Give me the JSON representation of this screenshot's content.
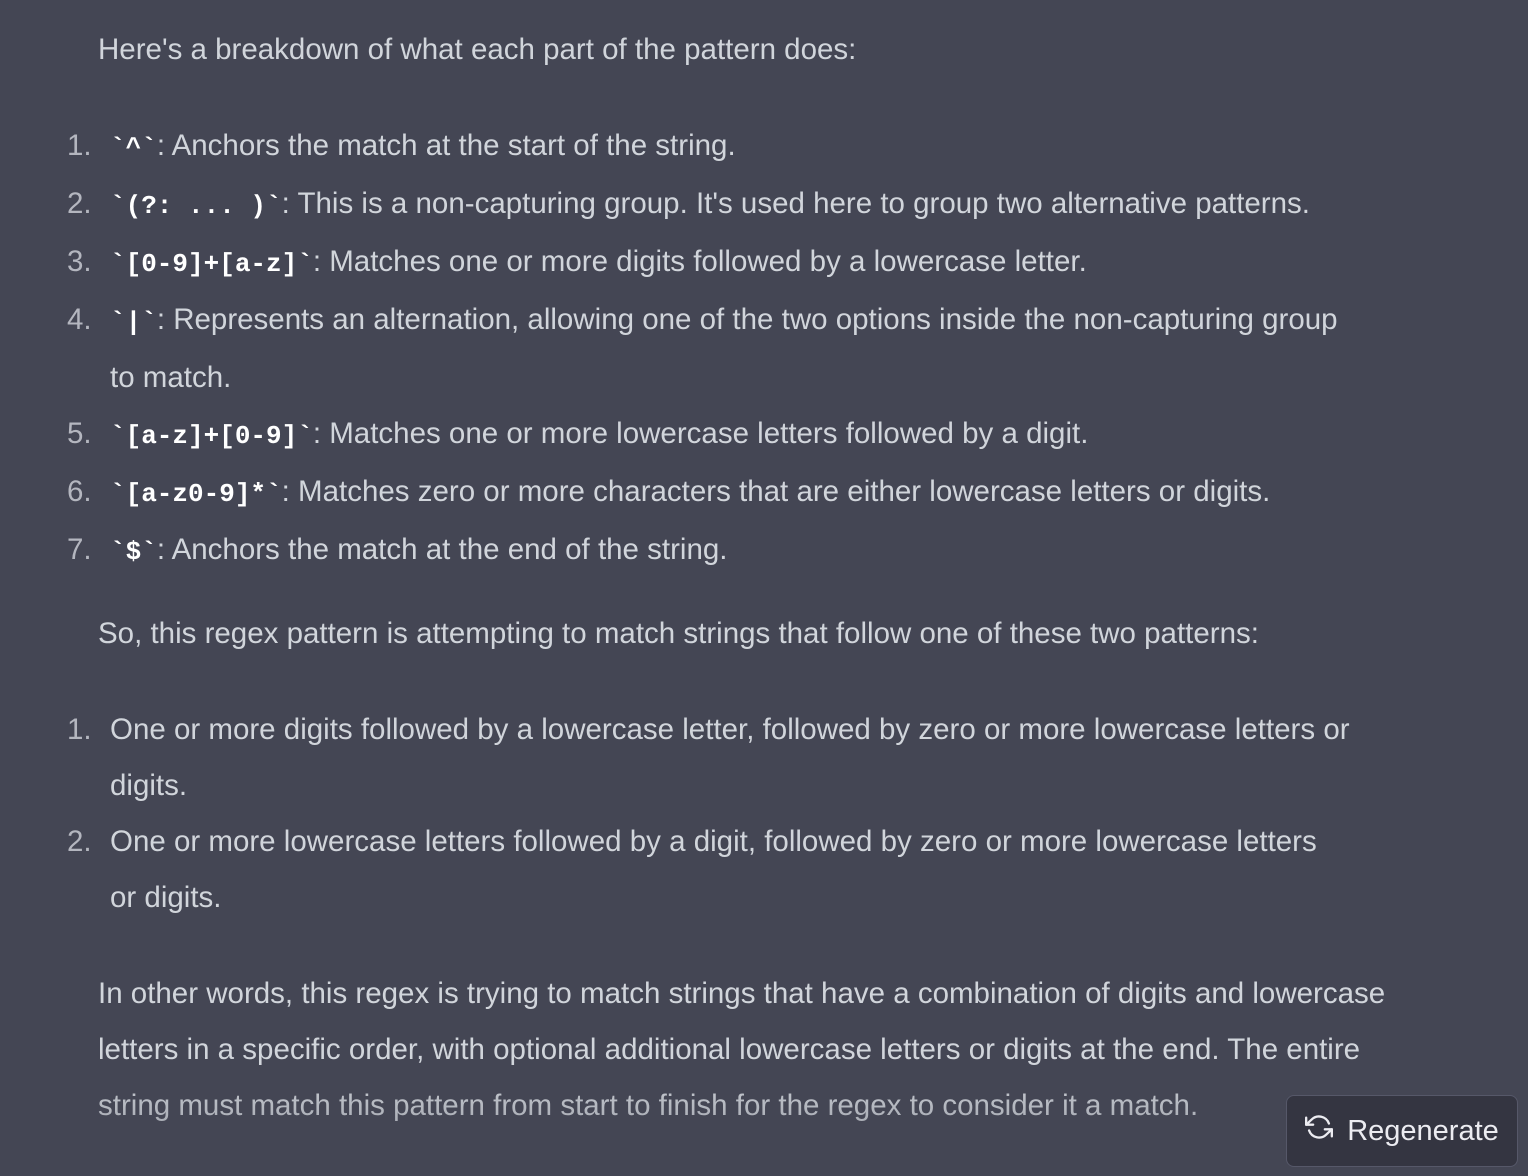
{
  "message": {
    "intro": "Here's a breakdown of what each part of the pattern does:",
    "breakdown": [
      {
        "num": "1.",
        "code": "`^`",
        "text": ": Anchors the match at the start of the string."
      },
      {
        "num": "2.",
        "code": "`(?: ... )`",
        "text": ": This is a non-capturing group. It's used here to group two alternative patterns."
      },
      {
        "num": "3.",
        "code": "`[0-9]+[a-z]`",
        "text": ": Matches one or more digits followed by a lowercase letter."
      },
      {
        "num": "4.",
        "code": "`|`",
        "text": ": Represents an alternation, allowing one of the two options inside the non-capturing group to match."
      },
      {
        "num": "5.",
        "code": "`[a-z]+[0-9]`",
        "text": ": Matches one or more lowercase letters followed by a digit."
      },
      {
        "num": "6.",
        "code": "`[a-z0-9]*`",
        "text": ": Matches zero or more characters that are either lowercase letters or digits."
      },
      {
        "num": "7.",
        "code": "`$`",
        "text": ": Anchors the match at the end of the string."
      }
    ],
    "summary_intro": "So, this regex pattern is attempting to match strings that follow one of these two patterns:",
    "patterns": [
      {
        "num": "1.",
        "text": "One or more digits followed by a lowercase letter, followed by zero or more lowercase letters or digits."
      },
      {
        "num": "2.",
        "text": "One or more lowercase letters followed by a digit, followed by zero or more lowercase letters or digits."
      }
    ],
    "conclusion": "In other words, this regex is trying to match strings that have a combination of digits and lowercase letters in a specific order, with optional additional lowercase letters or digits at the end. The entire string must match this pattern from start to finish for the regex to consider it a match."
  },
  "regenerate": {
    "label": "Regenerate",
    "icon": "refresh-icon"
  }
}
